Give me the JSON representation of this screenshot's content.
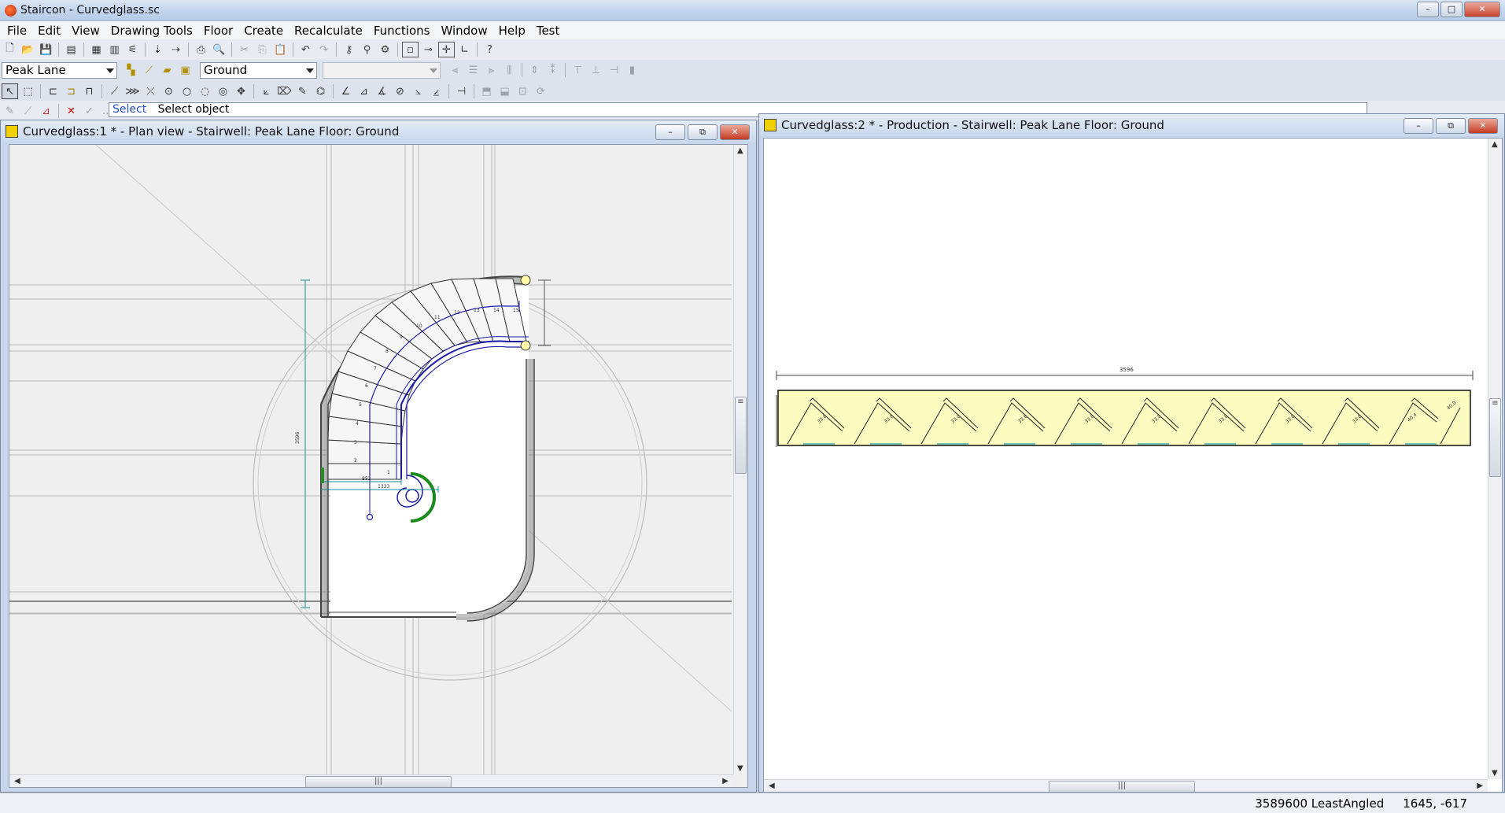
{
  "window": {
    "title": "Staircon - Curvedglass.sc",
    "minimize": "–",
    "maximize": "□",
    "close": "✕"
  },
  "menu": [
    "File",
    "Edit",
    "View",
    "Drawing Tools",
    "Floor",
    "Create",
    "Recalculate",
    "Functions",
    "Window",
    "Help",
    "Test"
  ],
  "toolbar": {
    "stairwell_combo": "Peak Lane",
    "floor_combo": "Ground",
    "empty_combo": ""
  },
  "command": {
    "keyword": "Select",
    "prompt": "Select object"
  },
  "plan_window": {
    "title": "Curvedglass:1 * - Plan view - Stairwell: Peak Lane  Floor: Ground",
    "minimize": "–",
    "restore": "⧉",
    "close": "✕",
    "step_numbers": [
      "1",
      "2",
      "3",
      "4",
      "5",
      "6",
      "7",
      "8",
      "9",
      "10",
      "11",
      "12",
      "13",
      "14",
      "15"
    ],
    "dim_width_small": "852",
    "dim_width_large": "1333",
    "dim_height": "3596"
  },
  "production_window": {
    "title": "Curvedglass:2 * - Production - Stairwell: Peak Lane  Floor: Ground",
    "minimize": "–",
    "restore": "⧉",
    "close": "✕",
    "dimension_label": "3596",
    "tread_labels": [
      "33.6",
      "33.8",
      "33.8",
      "33.8",
      "33.8",
      "33.8",
      "33.8",
      "33.8",
      "33.8",
      "40.4",
      "40.0"
    ]
  },
  "status": {
    "info": "3589600 LeastAngled",
    "coords": "1645,  -617"
  },
  "colors": {
    "stair_outline": "#1a1aaa",
    "teal_dim": "#1c8c9c",
    "green_volute": "#1a8a1a",
    "production_fill": "#fcfcc0",
    "handle_yellow": "#fff8a8"
  }
}
